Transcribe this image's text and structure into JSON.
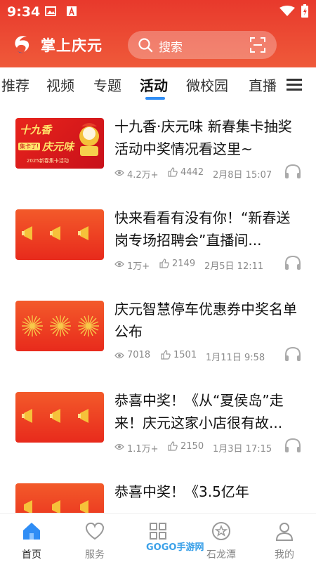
{
  "status_bar": {
    "time": "9:34"
  },
  "app": {
    "title": "掌上庆元"
  },
  "search": {
    "placeholder": "搜索"
  },
  "tabs": [
    {
      "label": "推荐"
    },
    {
      "label": "视频"
    },
    {
      "label": "专题"
    },
    {
      "label": "活动",
      "active": true
    },
    {
      "label": "微校园"
    },
    {
      "label": "直播"
    }
  ],
  "articles": [
    {
      "title": "十九香·庆元味 新春集卡抽奖活动中奖情况看这里~",
      "views": "4.2万+",
      "likes": "4442",
      "date": "2月8日 15:07",
      "thumb": {
        "main": "十九香",
        "sub": "庆元味",
        "badge": "集卡了!",
        "caption": "2025新春集卡活动"
      }
    },
    {
      "title": "快来看看有没有你！“新春送岗专场招聘会”直播间...",
      "views": "1万+",
      "likes": "2149",
      "date": "2月5日 12:11"
    },
    {
      "title": "庆元智慧停车优惠券中奖名单公布",
      "views": "7018",
      "likes": "1501",
      "date": "1月11日 9:58"
    },
    {
      "title": "恭喜中奖！《从“夏侯岛”走来！庆元这家小店很有故...",
      "views": "1.1万+",
      "likes": "2150",
      "date": "1月3日 17:15"
    },
    {
      "title": "恭喜中奖！《3.5亿年",
      "views": "",
      "likes": "",
      "date": ""
    }
  ],
  "bottom_nav": [
    {
      "label": "首页",
      "active": true
    },
    {
      "label": "服务"
    },
    {
      "label": ""
    },
    {
      "label": "石龙潭"
    },
    {
      "label": "我的"
    }
  ],
  "watermark": {
    "text": "GOGO手游网"
  },
  "colors": {
    "brand_red": "#e8392c",
    "accent_blue": "#2f8df5"
  }
}
